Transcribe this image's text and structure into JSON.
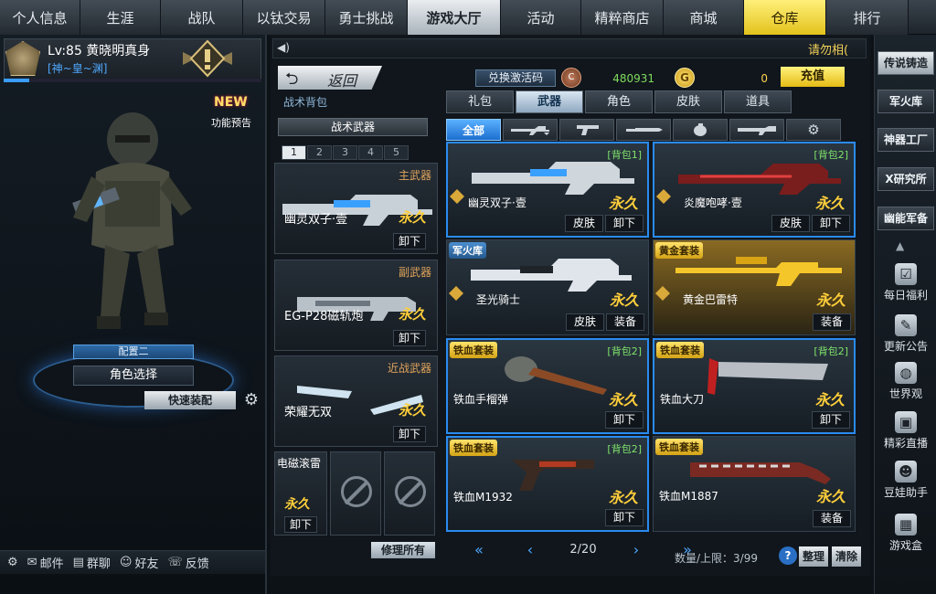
{
  "nav": {
    "tabs": [
      "个人信息",
      "生涯",
      "战队",
      "以钛交易",
      "勇士挑战",
      "游戏大厅",
      "活动",
      "精粹商店",
      "商城",
      "仓库",
      "排行"
    ]
  },
  "player": {
    "level_name": "Lv:85 黄晓明真身",
    "clan": "[神~皇~渊]",
    "xp_fraction": 0.1
  },
  "left": {
    "new_badge": "NEW",
    "new_label": "功能预告",
    "loadout": "配置二",
    "char_select": "角色选择",
    "quick_equip": "快速装配",
    "bottom": [
      {
        "icon": "gear-icon",
        "label": ""
      },
      {
        "icon": "mail-icon",
        "label": "邮件"
      },
      {
        "icon": "group-chat-icon",
        "label": "群聊"
      },
      {
        "icon": "friends-icon",
        "label": "好友"
      },
      {
        "icon": "feedback-icon",
        "label": "反馈"
      }
    ]
  },
  "header": {
    "notice": "请勿相(",
    "back": "返回",
    "bag_title": "战术背包",
    "redeem": "兑换激活码",
    "coin_c_symbol": "C",
    "coin_c_value": "480931",
    "coin_g_symbol": "G",
    "coin_g_value": "0",
    "recharge": "充值"
  },
  "category_tabs": [
    "礼包",
    "武器",
    "角色",
    "皮肤",
    "道具"
  ],
  "sub_tabs": [
    "全部"
  ],
  "bag": {
    "header": "战术武器",
    "pages": [
      "1",
      "2",
      "3",
      "4",
      "5"
    ],
    "slots": [
      {
        "type": "主武器",
        "name": "幽灵双子·壹",
        "perm": "永久",
        "btn": "卸下"
      },
      {
        "type": "副武器",
        "name": "EG-P28磁轨炮",
        "perm": "永久",
        "btn": "卸下"
      },
      {
        "type": "近战武器",
        "name": "荣耀无双",
        "perm": "永久",
        "btn": "卸下"
      }
    ],
    "grenade": {
      "name": "电磁滚雷",
      "perm": "永久",
      "btn": "卸下"
    },
    "repair": "修理所有"
  },
  "grid": [
    {
      "name": "幽灵双子·壹",
      "bag": "[背包1]",
      "tag": "",
      "perm": "永久",
      "btns": [
        "皮肤",
        "卸下"
      ]
    },
    {
      "name": "炎魔咆哮·壹",
      "bag": "[背包2]",
      "tag": "",
      "perm": "永久",
      "btns": [
        "皮肤",
        "卸下"
      ]
    },
    {
      "name": "圣光骑士",
      "bag": "",
      "tag": "军火库",
      "perm": "永久",
      "btns": [
        "皮肤",
        "装备"
      ]
    },
    {
      "name": "黄金巴雷特",
      "bag": "",
      "tag": "黄金套装",
      "perm": "永久",
      "btns": [
        "装备"
      ]
    },
    {
      "name": "铁血手榴弹",
      "bag": "[背包2]",
      "tag": "铁血套装",
      "perm": "永久",
      "btns": [
        "卸下"
      ]
    },
    {
      "name": "铁血大刀",
      "bag": "[背包2]",
      "tag": "铁血套装",
      "perm": "永久",
      "btns": [
        "卸下"
      ]
    },
    {
      "name": "铁血M1932",
      "bag": "[背包2]",
      "tag": "铁血套装",
      "perm": "永久",
      "btns": [
        "卸下"
      ]
    },
    {
      "name": "铁血M1887",
      "bag": "",
      "tag": "铁血套装",
      "perm": "永久",
      "btns": [
        "装备"
      ]
    }
  ],
  "pager": {
    "page": "2/20",
    "capacity": "数量/上限：3/99",
    "sort": "整理",
    "clear": "清除"
  },
  "right": {
    "buttons": [
      "传说铸造",
      "军火库",
      "神器工厂",
      "X研究所",
      "幽能军备"
    ],
    "items": [
      {
        "icon": "checklist-icon",
        "label": "每日福利"
      },
      {
        "icon": "chat-icon",
        "label": "更新公告"
      },
      {
        "icon": "globe-icon",
        "label": "世界观"
      },
      {
        "icon": "camera-icon",
        "label": "精彩直播"
      },
      {
        "icon": "mascot-icon",
        "label": "豆娃助手"
      },
      {
        "icon": "game-box-icon",
        "label": "游戏盒"
      }
    ]
  },
  "colors": {
    "accent": "#2a8bf0",
    "gold": "#ffcf3a",
    "bag_green": "#7fe36a"
  }
}
